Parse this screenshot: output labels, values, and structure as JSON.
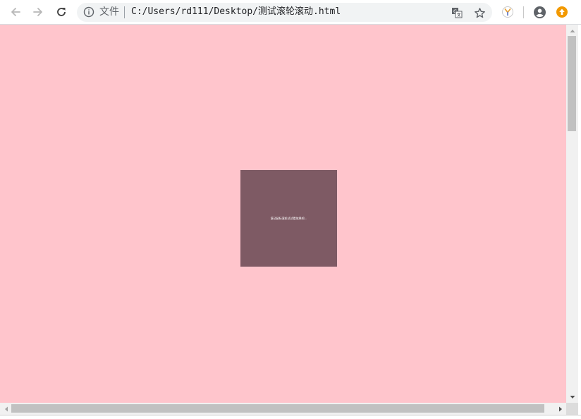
{
  "browser": {
    "omnibox": {
      "security_label": "文件",
      "url": "C:/Users/rd111/Desktop/测试滚轮滚动.html"
    },
    "icons": {
      "back": "arrow-back-icon",
      "forward": "arrow-forward-icon",
      "reload": "reload-icon",
      "info": "info-icon",
      "translate": "translate-icon",
      "bookmark": "star-icon",
      "extension": "extension-y-icon",
      "account": "account-icon",
      "update": "update-icon"
    }
  },
  "page": {
    "background_color": "#ffc5cc",
    "box_color": "#7e5a64",
    "box_text": "滚动鼠标滚轮试试看效果吧..."
  }
}
